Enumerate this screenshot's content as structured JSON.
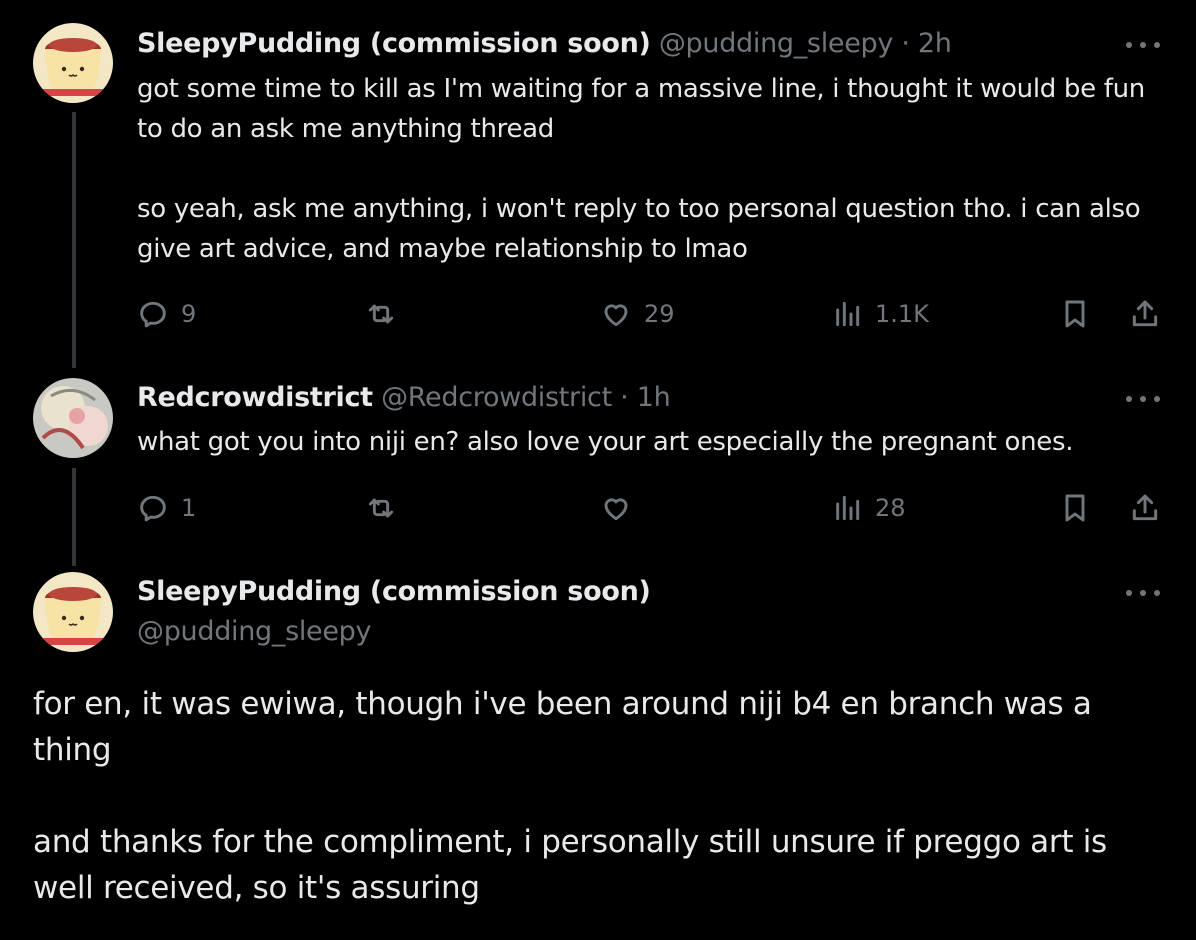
{
  "tweets": [
    {
      "name": "SleepyPudding (commission soon)",
      "handle": "@pudding_sleepy",
      "sep": " · ",
      "time": "2h",
      "text_p1": "got some time to kill as I'm waiting for a massive line, i thought it would be fun to do an ask me anything thread",
      "text_p2": "so yeah, ask me anything, i won't reply to too personal question tho. i can also give art advice, and maybe relationship to lmao",
      "replies": "9",
      "reposts": "",
      "likes": "29",
      "views": "1.1K"
    },
    {
      "name": "Redcrowdistrict",
      "handle": "@Redcrowdistrict",
      "sep": " · ",
      "time": "1h",
      "text": "what got you into niji en? also love your art especially the pregnant ones.",
      "replies": "1",
      "reposts": "",
      "likes": "",
      "views": "28"
    }
  ],
  "main": {
    "name": "SleepyPudding (commission soon)",
    "handle": "@pudding_sleepy",
    "text_p1": "for en, it was ewiwa, though i've been around niji b4 en branch was a thing",
    "text_p2": "and thanks for the compliment, i personally still unsure if preggo art is well received, so it's assuring"
  },
  "colors": {
    "background": "#000000",
    "text": "#e7e9ea",
    "muted": "#71767b",
    "thread_line": "#333639"
  },
  "icons": [
    "reply-icon",
    "repost-icon",
    "like-icon",
    "views-icon",
    "bookmark-icon",
    "share-icon",
    "more-icon"
  ]
}
